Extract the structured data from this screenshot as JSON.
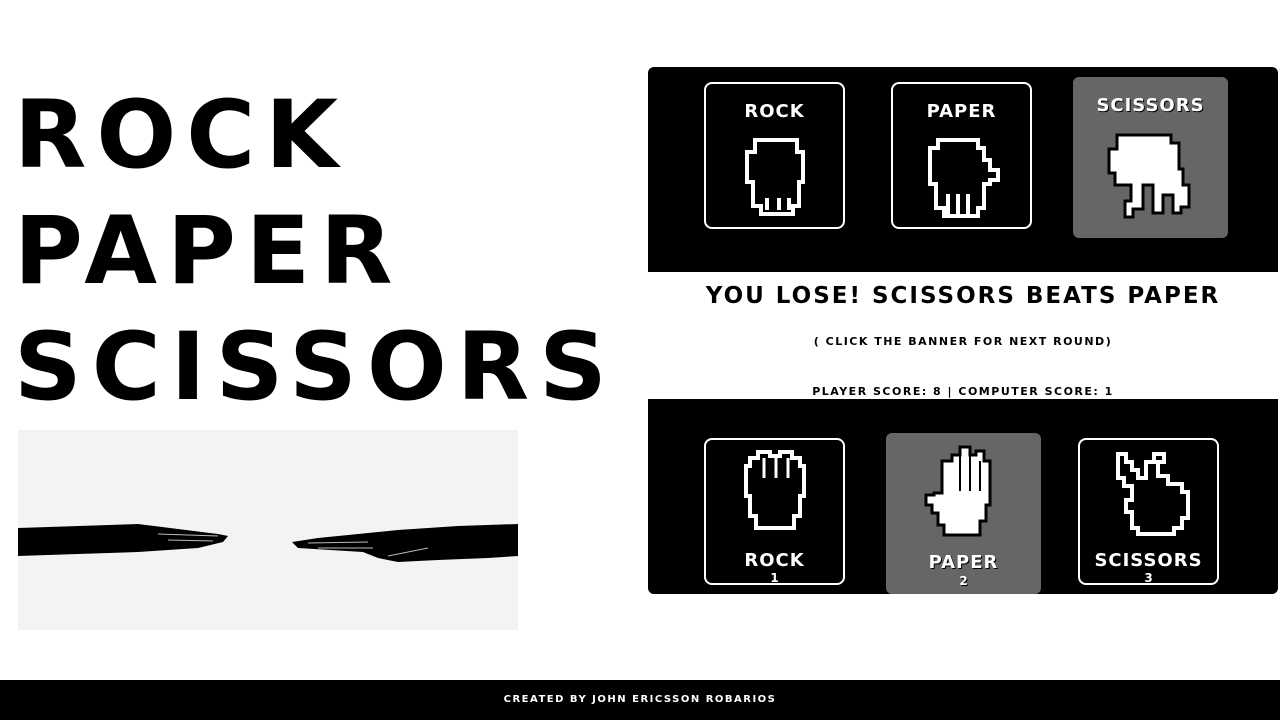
{
  "title": {
    "line1": "ROCK",
    "line2": "PAPER",
    "line3": "SCISSORS"
  },
  "hero_image": {
    "icon": "hands-reaching-image"
  },
  "computer_choices": [
    {
      "label": "ROCK",
      "icon": "pixel-fist-icon",
      "selected": false
    },
    {
      "label": "PAPER",
      "icon": "pixel-fist-icon",
      "selected": false
    },
    {
      "label": "SCISSORS",
      "icon": "pixel-scissors-hand-icon",
      "selected": true
    }
  ],
  "result": {
    "message": "YOU LOSE! SCISSORS BEATS PAPER",
    "hint": "( CLICK THE BANNER FOR NEXT ROUND)"
  },
  "score": {
    "text": "PLAYER SCORE: 8 | COMPUTER SCORE: 1"
  },
  "player_choices": [
    {
      "label": "ROCK",
      "key": "1",
      "icon": "pixel-fist-icon",
      "selected": false
    },
    {
      "label": "PAPER",
      "key": "2",
      "icon": "pixel-open-hand-icon",
      "selected": true
    },
    {
      "label": "SCISSORS",
      "key": "3",
      "icon": "pixel-peace-hand-icon",
      "selected": false
    }
  ],
  "footer": {
    "credit": "CREATED BY JOHN ERICSSON ROBARIOS"
  },
  "colors": {
    "panel": "#000000",
    "selected": "#666666",
    "text": "#ffffff",
    "background": "#ffffff"
  }
}
